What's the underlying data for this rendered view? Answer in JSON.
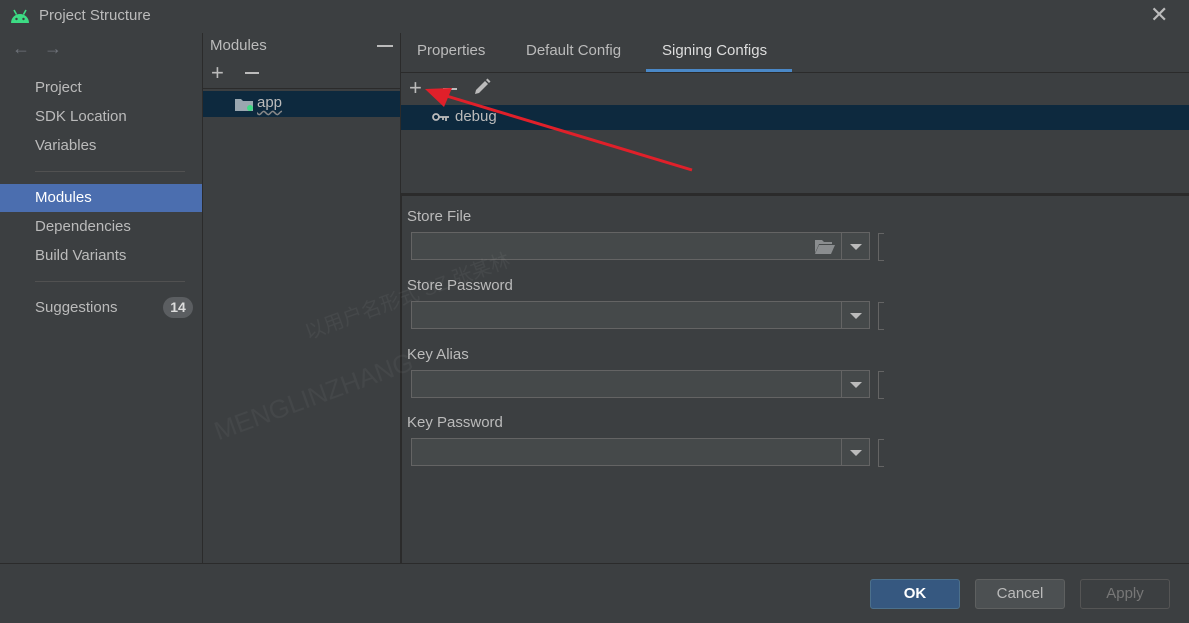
{
  "window": {
    "title": "Project Structure",
    "close_icon": "close-icon",
    "app_icon": "android-icon"
  },
  "nav": {
    "back_icon": "arrow-left-icon",
    "forward_icon": "arrow-right-icon",
    "items": [
      {
        "label": "Project",
        "selected": false
      },
      {
        "label": "SDK Location",
        "selected": false
      },
      {
        "label": "Variables",
        "selected": false
      },
      {
        "label": "Modules",
        "selected": true
      },
      {
        "label": "Dependencies",
        "selected": false
      },
      {
        "label": "Build Variants",
        "selected": false
      },
      {
        "label": "Suggestions",
        "selected": false
      }
    ],
    "suggestions_count": "14"
  },
  "modules": {
    "header": "Modules",
    "items": [
      {
        "label": "app",
        "icon": "module-folder-icon",
        "selected": true
      }
    ]
  },
  "tabs": [
    {
      "label": "Properties",
      "active": false
    },
    {
      "label": "Default Config",
      "active": false
    },
    {
      "label": "Signing Configs",
      "active": true
    }
  ],
  "signing": {
    "configs": [
      {
        "label": "debug",
        "icon": "key-icon",
        "selected": true
      }
    ],
    "fields": [
      {
        "label": "Store File",
        "value": ""
      },
      {
        "label": "Store Password",
        "value": ""
      },
      {
        "label": "Key Alias",
        "value": ""
      },
      {
        "label": "Key Password",
        "value": ""
      }
    ]
  },
  "watermark": {
    "line1": "以用户名形式 SZ 张某林",
    "line2": "MENGLINZHANG"
  },
  "buttons": {
    "ok": "OK",
    "cancel": "Cancel",
    "apply": "Apply"
  },
  "colors": {
    "background": "#3c3f41",
    "selection_nav": "#4b6eaf",
    "selection_list": "#0d293e",
    "tab_underline": "#4a88c7",
    "ok_button": "#365880",
    "annotation_arrow": "#e0202a",
    "android_green": "#3ddc84"
  }
}
